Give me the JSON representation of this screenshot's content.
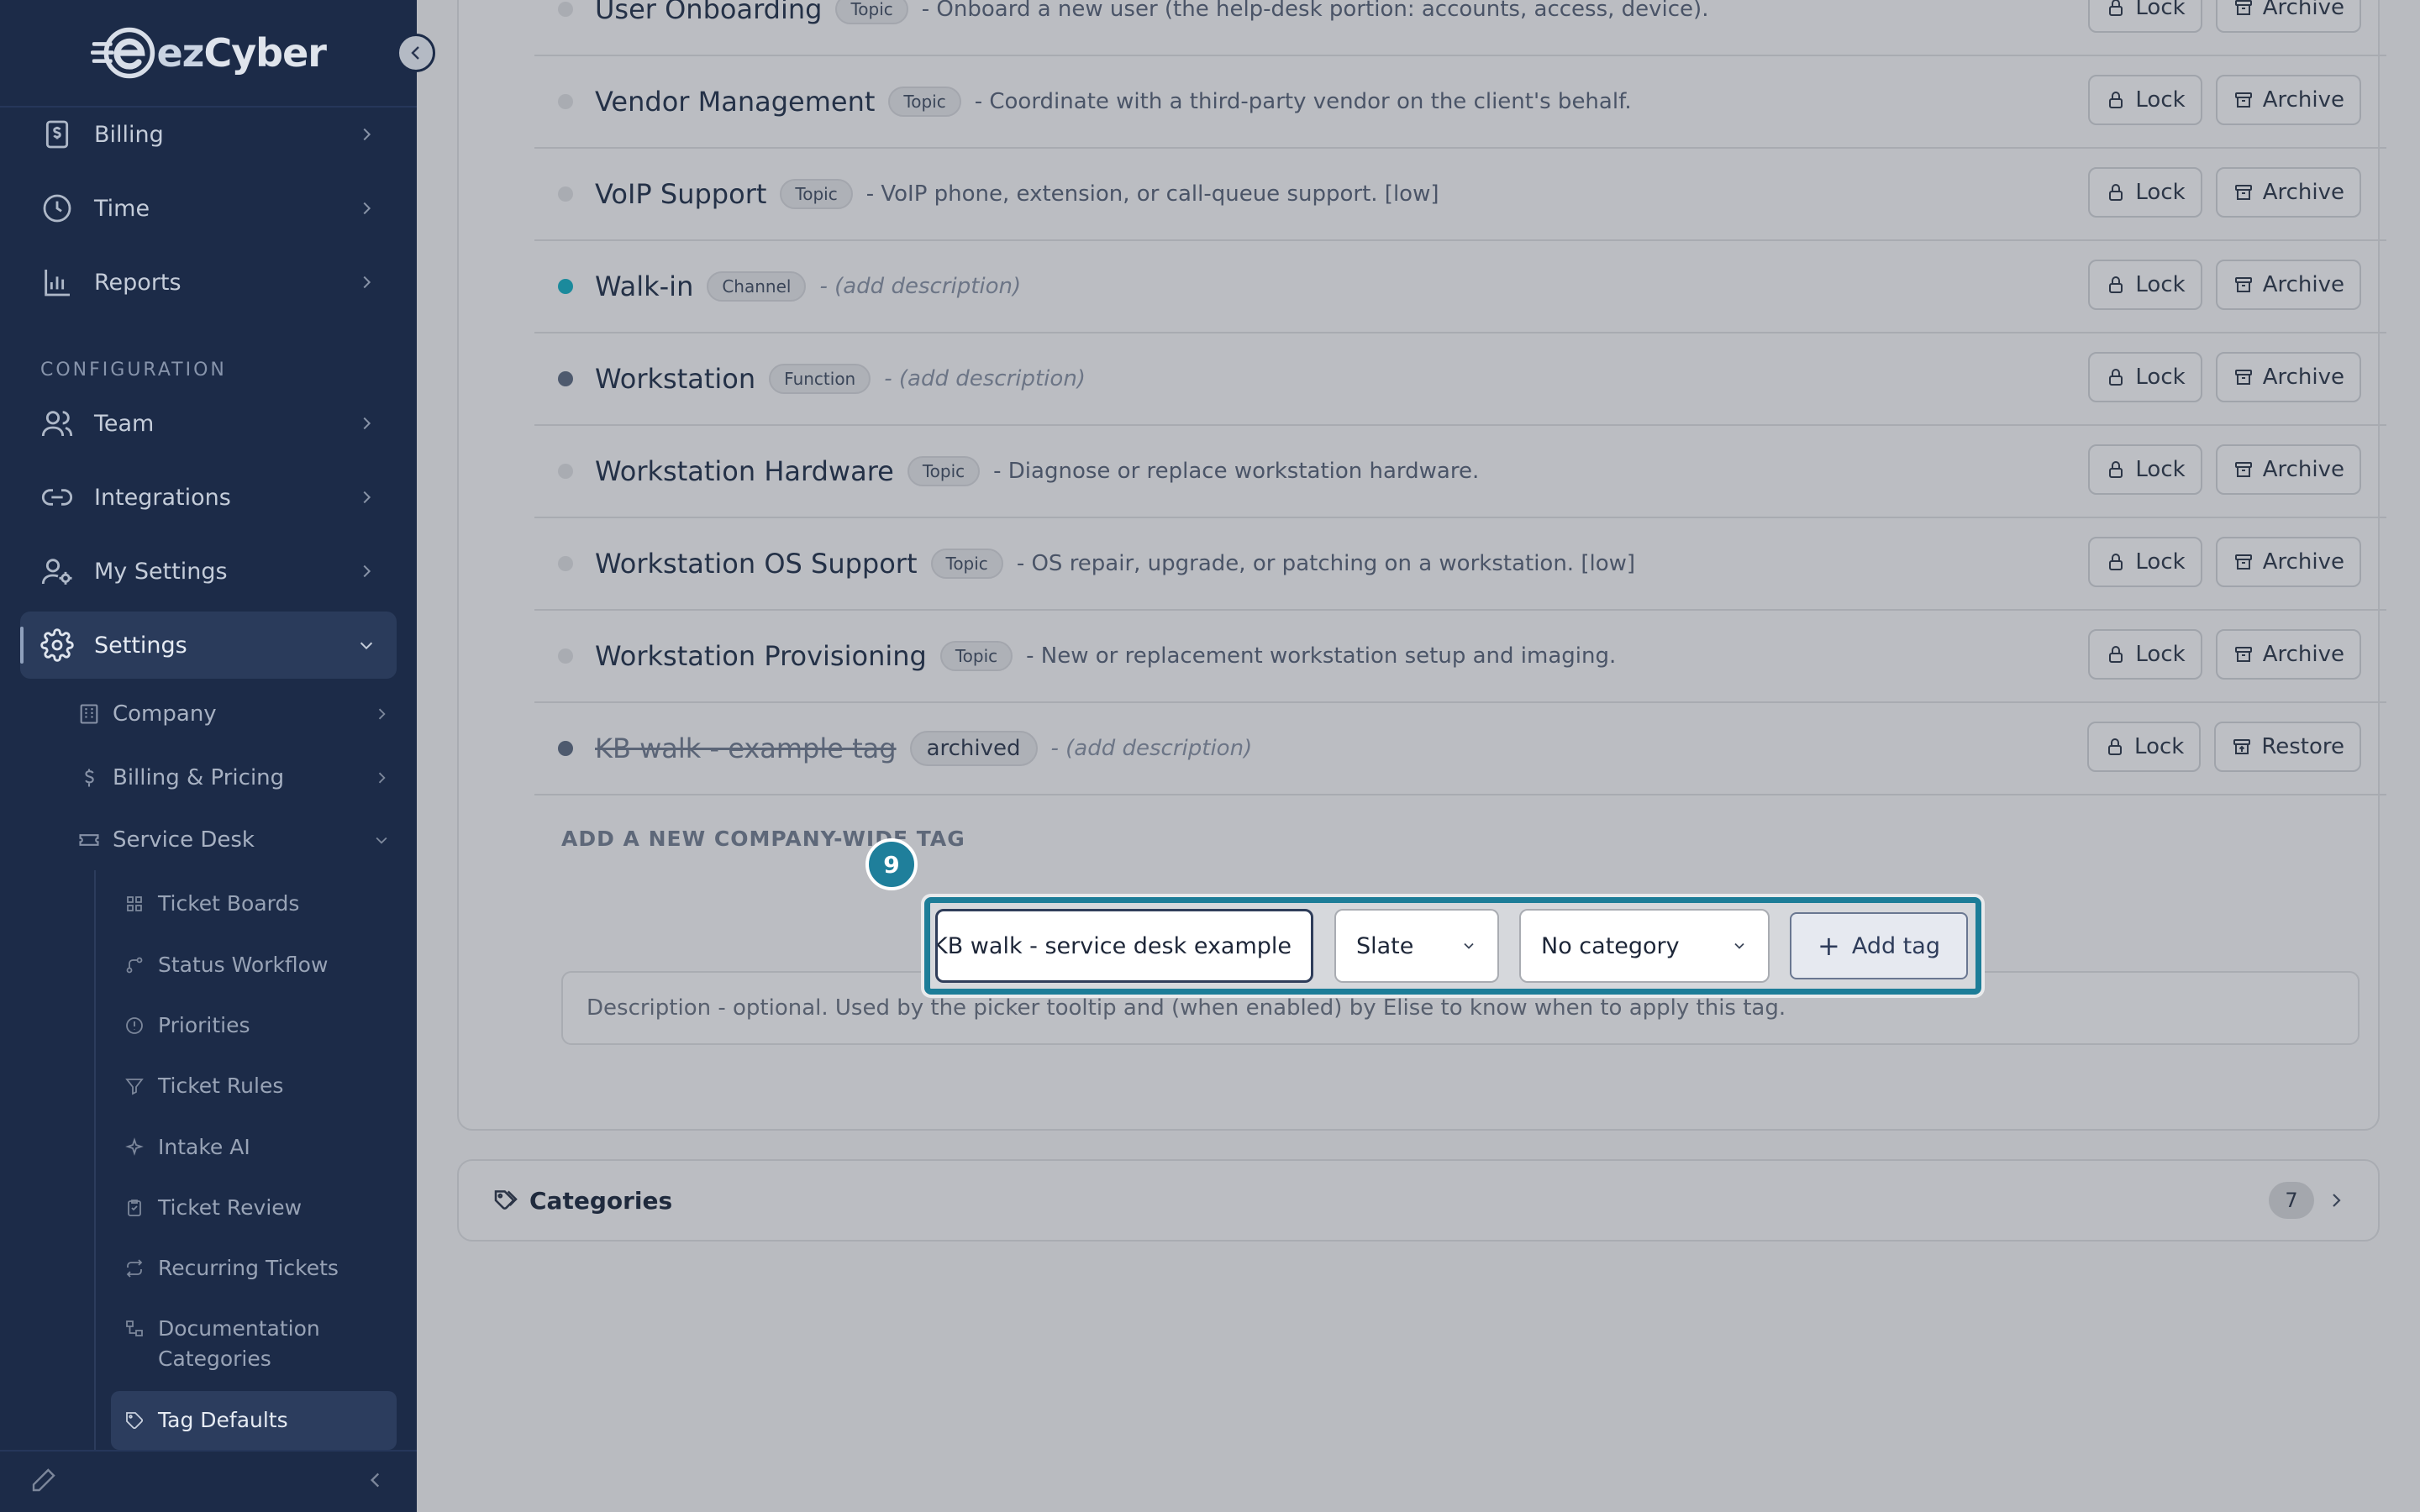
{
  "brand": {
    "name_prefix": "ez",
    "name_suffix": "Cyber"
  },
  "sidebar": {
    "nav": [
      {
        "label": "Billing",
        "icon": "dollar-doc-icon"
      },
      {
        "label": "Time",
        "icon": "clock-icon"
      },
      {
        "label": "Reports",
        "icon": "bar-chart-icon"
      }
    ],
    "section_label": "CONFIGURATION",
    "config_nav": [
      {
        "label": "Team",
        "icon": "users-icon"
      },
      {
        "label": "Integrations",
        "icon": "link-icon"
      },
      {
        "label": "My Settings",
        "icon": "user-gear-icon"
      },
      {
        "label": "Settings",
        "icon": "gear-icon"
      }
    ],
    "settings_children": [
      {
        "label": "Company",
        "icon": "building-icon"
      },
      {
        "label": "Billing & Pricing",
        "icon": "dollar-icon"
      },
      {
        "label": "Service Desk",
        "icon": "ticket-icon"
      }
    ],
    "service_desk_children": [
      {
        "label": "Ticket Boards",
        "icon": "grid-icon"
      },
      {
        "label": "Status Workflow",
        "icon": "workflow-icon"
      },
      {
        "label": "Priorities",
        "icon": "alert-circle-icon"
      },
      {
        "label": "Ticket Rules",
        "icon": "filter-icon"
      },
      {
        "label": "Intake AI",
        "icon": "sparkle-icon"
      },
      {
        "label": "Ticket Review",
        "icon": "clipboard-icon"
      },
      {
        "label": "Recurring Tickets",
        "icon": "repeat-icon"
      },
      {
        "label": "Documentation Categories",
        "icon": "doc-tree-icon"
      },
      {
        "label": "Tag Defaults",
        "icon": "tag-icon"
      }
    ]
  },
  "tags": [
    {
      "name": "User Onboarding",
      "chip": "Topic",
      "desc": "- Onboard a new user (the help-desk portion: accounts, access, device).",
      "dot": "#a9acb2",
      "placeholder": false,
      "archived": false
    },
    {
      "name": "Vendor Management",
      "chip": "Topic",
      "desc": "- Coordinate with a third-party vendor on the client's behalf.",
      "dot": "#a9acb2",
      "placeholder": false,
      "archived": false
    },
    {
      "name": "VoIP Support",
      "chip": "Topic",
      "desc": "- VoIP phone, extension, or call-queue support. [low]",
      "dot": "#a9acb2",
      "placeholder": false,
      "archived": false
    },
    {
      "name": "Walk-in",
      "chip": "Channel",
      "desc": "- (add description)",
      "dot": "#1b8a9c",
      "placeholder": true,
      "archived": false
    },
    {
      "name": "Workstation",
      "chip": "Function",
      "desc": "- (add description)",
      "dot": "#4e5a6e",
      "placeholder": true,
      "archived": false
    },
    {
      "name": "Workstation Hardware",
      "chip": "Topic",
      "desc": "- Diagnose or replace workstation hardware.",
      "dot": "#a9acb2",
      "placeholder": false,
      "archived": false
    },
    {
      "name": "Workstation OS Support",
      "chip": "Topic",
      "desc": "- OS repair, upgrade, or patching on a workstation. [low]",
      "dot": "#a9acb2",
      "placeholder": false,
      "archived": false
    },
    {
      "name": "Workstation Provisioning",
      "chip": "Topic",
      "desc": "- New or replacement workstation setup and imaging.",
      "dot": "#a9acb2",
      "placeholder": false,
      "archived": false
    },
    {
      "name": "KB walk - example tag",
      "chip": "archived",
      "desc": "- (add description)",
      "dot": "#4e5a6e",
      "placeholder": true,
      "archived": true
    }
  ],
  "actions": {
    "lock": "Lock",
    "archive": "Archive",
    "restore": "Restore"
  },
  "add_form": {
    "heading": "ADD A NEW COMPANY-WIDE TAG",
    "step": "9",
    "name_value": "KB walk - service desk example",
    "color_value": "Slate",
    "category_value": "No category",
    "add_label": "Add tag",
    "description_placeholder": "Description - optional. Used by the picker tooltip and (when enabled) by Elise to know when to apply this tag."
  },
  "categories": {
    "title": "Categories",
    "count": "7"
  }
}
